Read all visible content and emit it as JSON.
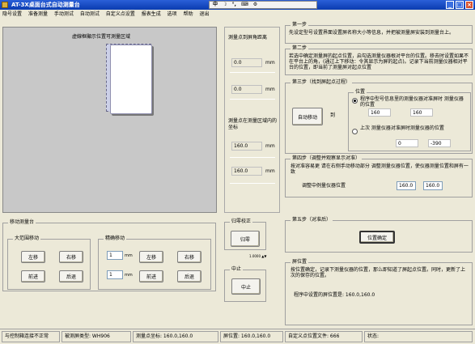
{
  "window": {
    "title": "AT-3X桌面台式自动测量台"
  },
  "ime_bar": {
    "items": [
      "中",
      "☽",
      "°,",
      "⌨",
      "⚙"
    ]
  },
  "menu": [
    "隐号设置",
    "准备测量",
    "手动测试",
    "自动测试",
    "自定义点设置",
    "报表生成",
    "选项",
    "帮助",
    "退出"
  ],
  "preview": {
    "label": "虚線框顯示位置可測量区域",
    "colors": {
      "area": "#ccd0e8",
      "card": "#ffffff",
      "outline": "#9090b0"
    }
  },
  "middle": {
    "distance_title": "測量点到屏角距离",
    "field1": "0.0",
    "unit1": "mm",
    "field2": "0.0",
    "unit2": "mm",
    "coords_title": "測量点在测量区域内的坐标",
    "field3": "160.0",
    "unit3": "mm",
    "field4": "160.0",
    "unit4": "mm"
  },
  "step1": {
    "title": "第一步",
    "text": "先设定型号设置界面设置屏名称大小等信息，并把被测量屏安装到测量台上。"
  },
  "step2": {
    "title": "第二步",
    "text": "若选中确定测量屏的起点位置，启勾选测量仪器根对平台的位置。移去时设置如果不在平台上的角，(通过上下移动：令其显示为屏的起点)。记录下当前测量仪器相对平台的位置，即当前了测量屏对起点位置"
  },
  "step3": {
    "title": "第三步（找到屏起点过程）",
    "auto_button": "自动移动",
    "to_label": "到",
    "position_title": "位置",
    "radio1_label": "程序中型号信息里的测量仪器对准屏时  测量仪器的位置",
    "radio1_x": "160",
    "radio1_y": "160",
    "radio2_label": "上次  测量仪器对准屏时测量仪器的位置",
    "radio2_x": "0",
    "radio2_y": "-390"
  },
  "step4": {
    "title": "第四步（调整并观察显示对准）",
    "text": "按对准容易更  请在右侧手动移动部分  调整测量仪器位置，使仪器测量位置和屏有一致",
    "field_label": "调整中例量仪器位置",
    "field_x": "160.0",
    "field_y": "160.0"
  },
  "step5": {
    "title": "第五步（对准后）",
    "confirm_button": "位置确定"
  },
  "screen_pos": {
    "title": "屏位置",
    "text": "按位置确定，记录下测量仪器的位置，那么即知道了屏起点位置。同时，更新了上次的保存的位置。",
    "current_label": "程序中设置的屏位置是: 160.0,160.0"
  },
  "move_platform": {
    "title": "移动测量台",
    "coarse_title": "大范围移动",
    "left": "左移",
    "right": "右移",
    "forward": "前进",
    "back": "后退",
    "fine_title": "精确移动",
    "fine_x": "1",
    "fine_x_unit": "mm",
    "fine_y": "1",
    "fine_y_unit": "mm",
    "fine_left": "左移",
    "fine_right": "右移",
    "fine_forward": "前进",
    "fine_back": "后退"
  },
  "zero_cal": {
    "title": "归零校正",
    "button": "归零",
    "step_label": "1.0000 ▲▼"
  },
  "stop": {
    "title": "中止",
    "button": "中止"
  },
  "status": [
    "与控制箱连接不正常",
    "被测屏类型: WH906",
    "测量点坐标: 160.0,160.0",
    "屏位置: 160.0,160.0",
    "自定义点位置文件: 666",
    "状态:"
  ]
}
